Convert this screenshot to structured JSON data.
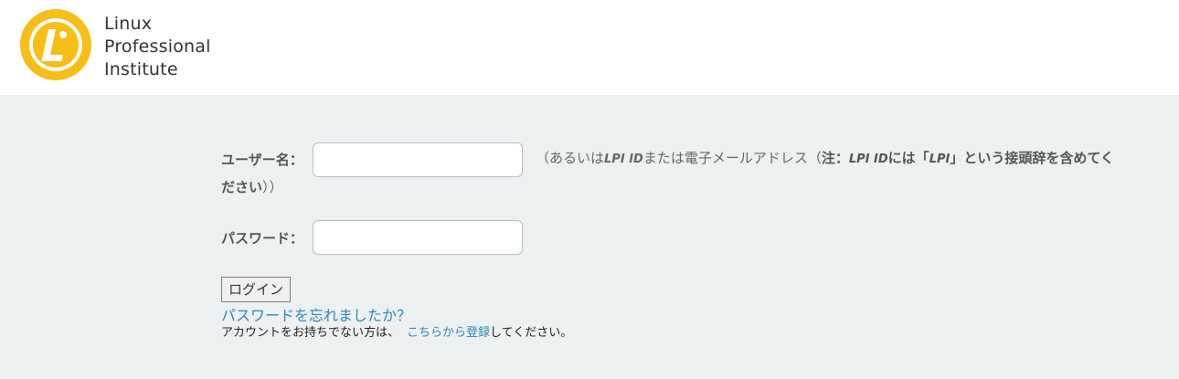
{
  "header": {
    "logo_lines": [
      "Linux",
      "Professional",
      "Institute"
    ],
    "brand_color": "#f6be16"
  },
  "form": {
    "username_label": "ユーザー名：",
    "username_value": "",
    "username_hint": {
      "open": "（あるいは",
      "lpi_id_1": "LPI ID",
      "mid": "または電子メールアドレス（",
      "note": "注：",
      "lpi_id_2": "LPI ID",
      "rest1": "には「",
      "lpi": "LPI",
      "rest2": "」という接頭辞を含めてください",
      "close": "））"
    },
    "password_label": "パスワード：",
    "password_value": "",
    "login_button": "ログイン",
    "forgot_link": "パスワードを忘れましたか？",
    "register_prefix": "アカウントをお持ちでない方は、",
    "register_link": "こちらから登録",
    "register_suffix": "してください。"
  }
}
